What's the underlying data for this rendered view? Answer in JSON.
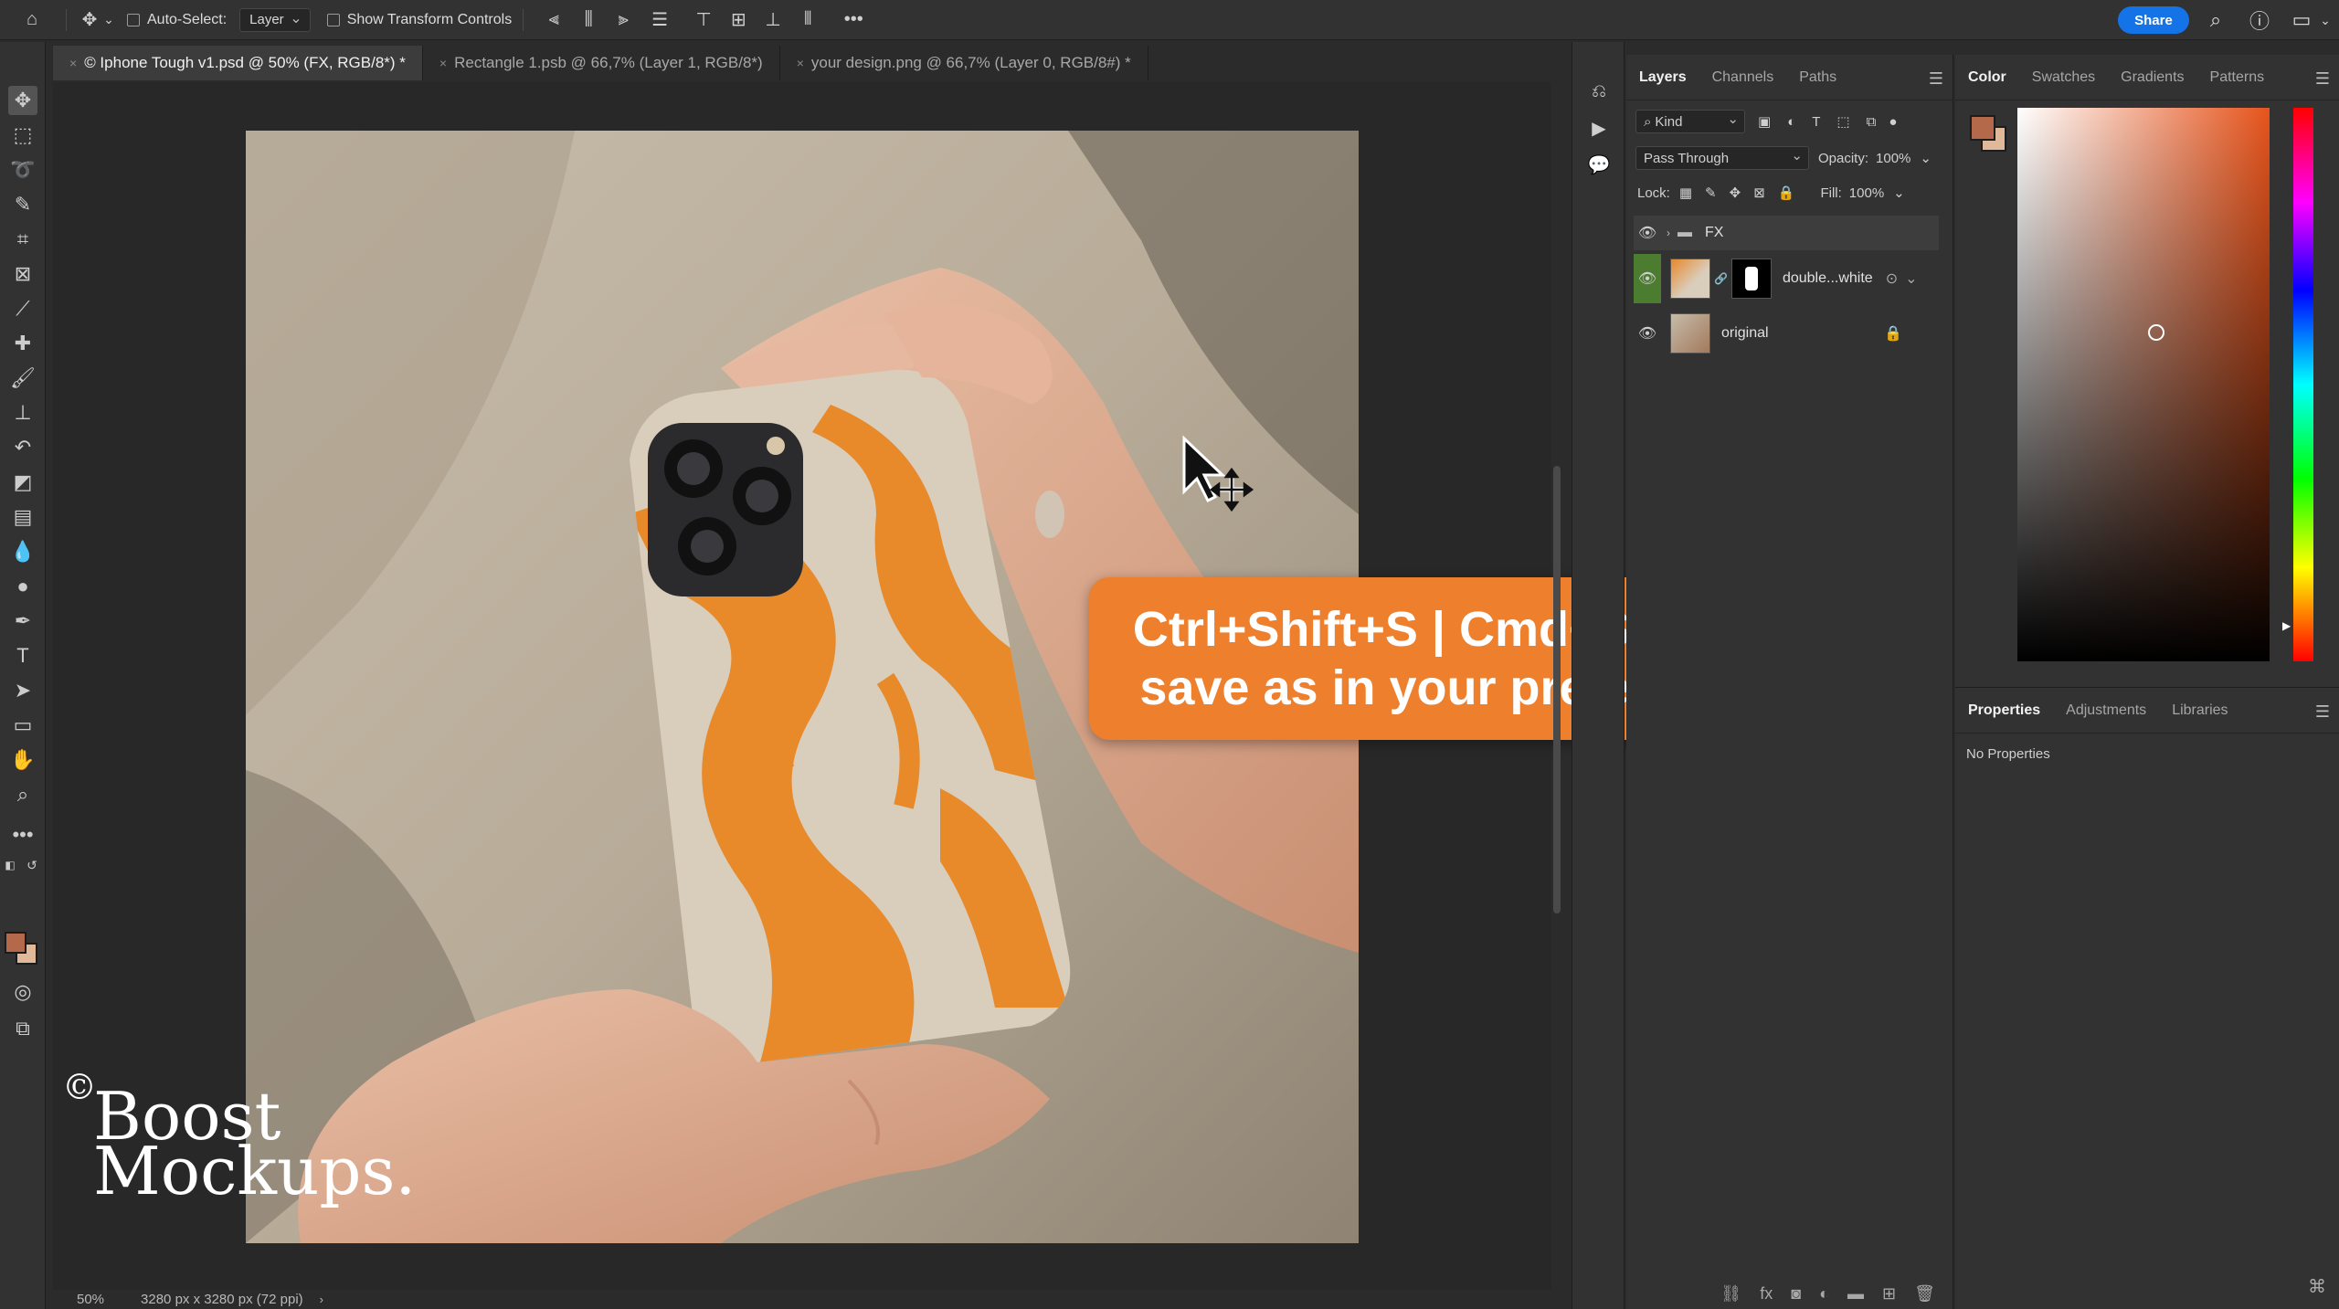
{
  "options_bar": {
    "auto_select_label": "Auto-Select:",
    "auto_select_value": "Layer",
    "transform_label": "Show Transform Controls",
    "share_label": "Share"
  },
  "document_tabs": [
    {
      "label": "© Iphone Tough v1.psd @ 50% (FX, RGB/8*) *",
      "active": true
    },
    {
      "label": "Rectangle 1.psb @ 66,7% (Layer 1, RGB/8*)",
      "active": false
    },
    {
      "label": "your design.png @ 66,7% (Layer 0, RGB/8#) *",
      "active": false
    }
  ],
  "status_bar": {
    "zoom": "50%",
    "doc_size": "3280 px x 3280 px (72 ppi)"
  },
  "caption": {
    "line1": "Ctrl+Shift+S | Cmd+Shift+S(mac)",
    "line2": "save as in your preferred format"
  },
  "watermark": {
    "symbol": "©",
    "line1": "Boost",
    "line2": "Mockups."
  },
  "layers_panel": {
    "tabs": [
      "Layers",
      "Channels",
      "Paths"
    ],
    "filter_value": "Kind",
    "blend_mode": "Pass Through",
    "opacity_label": "Opacity:",
    "opacity_value": "100%",
    "lock_label": "Lock:",
    "fill_label": "Fill:",
    "fill_value": "100%",
    "layers": [
      {
        "name": "FX",
        "kind": "group"
      },
      {
        "name": "double...white",
        "kind": "smart-object-masked"
      },
      {
        "name": "original",
        "kind": "locked"
      }
    ]
  },
  "color_panel": {
    "tabs": [
      "Color",
      "Swatches",
      "Gradients",
      "Patterns"
    ],
    "foreground": "#b46a4a",
    "background": "#e0b89a"
  },
  "properties_panel": {
    "tabs": [
      "Properties",
      "Adjustments",
      "Libraries"
    ],
    "empty_text": "No Properties"
  },
  "colors": {
    "accent_blue": "#1473e6",
    "caption_orange": "#ee7f2d",
    "case_orange": "#e8892a"
  }
}
